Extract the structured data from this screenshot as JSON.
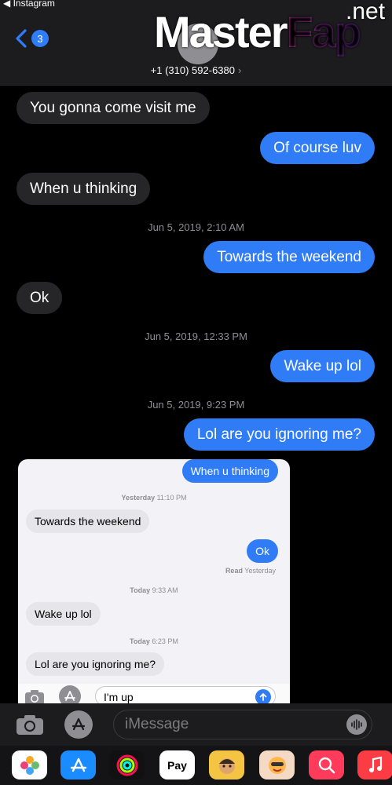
{
  "status_bar": {
    "back_app": "◀ Instagram"
  },
  "header": {
    "back_count": "3",
    "contact": "+1 (310) 592-6380",
    "contact_chevron": "›"
  },
  "watermark": {
    "master": "Master",
    "fap": "Fap",
    "net": ".net"
  },
  "messages": [
    {
      "dir": "in",
      "text": "You gonna come visit me"
    },
    {
      "dir": "out",
      "text": "Of course luv"
    },
    {
      "dir": "in",
      "text": "When u thinking"
    },
    {
      "type": "timestamp",
      "text": "Jun 5, 2019, 2:10 AM"
    },
    {
      "dir": "out",
      "text": "Towards the weekend"
    },
    {
      "dir": "in",
      "text": "Ok"
    },
    {
      "type": "timestamp",
      "text": "Jun 5, 2019, 12:33 PM"
    },
    {
      "dir": "out",
      "text": "Wake up lol"
    },
    {
      "type": "timestamp",
      "text": "Jun 5, 2019, 9:23 PM"
    },
    {
      "dir": "out",
      "text": "Lol are you ignoring me?"
    }
  ],
  "screenshot": {
    "messages": [
      {
        "dir": "out",
        "text": "When u thinking"
      },
      {
        "type": "timestamp",
        "day": "Yesterday",
        "time": "11:10 PM"
      },
      {
        "dir": "in",
        "text": "Towards the weekend"
      },
      {
        "dir": "out",
        "text": "Ok"
      },
      {
        "type": "read",
        "label": "Read",
        "when": "Yesterday"
      },
      {
        "type": "timestamp",
        "day": "Today",
        "time": "9:33 AM"
      },
      {
        "dir": "in",
        "text": "Wake up lol"
      },
      {
        "type": "timestamp",
        "day": "Today",
        "time": "6:23 PM"
      },
      {
        "dir": "in",
        "text": "Lol are you ignoring me?"
      }
    ],
    "input_value": "I'm up"
  },
  "input_bar": {
    "placeholder": "iMessage"
  },
  "dock": {
    "apps": [
      {
        "name": "Photos",
        "color": "#ffffff"
      },
      {
        "name": "App Store",
        "color": "#1a8cff"
      },
      {
        "name": "Activity",
        "color": "#111111"
      },
      {
        "name": "Apple Pay",
        "label": "Pay",
        "color": "#ffffff"
      },
      {
        "name": "Memoji",
        "color": "#f4c542"
      },
      {
        "name": "Animoji",
        "color": "#f4d9c4"
      },
      {
        "name": "Web Search",
        "color": "#ff3b5c"
      },
      {
        "name": "Music",
        "color": "#fc3c44"
      }
    ]
  },
  "colors": {
    "accent": "#2f7cf6",
    "incoming_bubble": "#262628",
    "background": "#000000"
  }
}
